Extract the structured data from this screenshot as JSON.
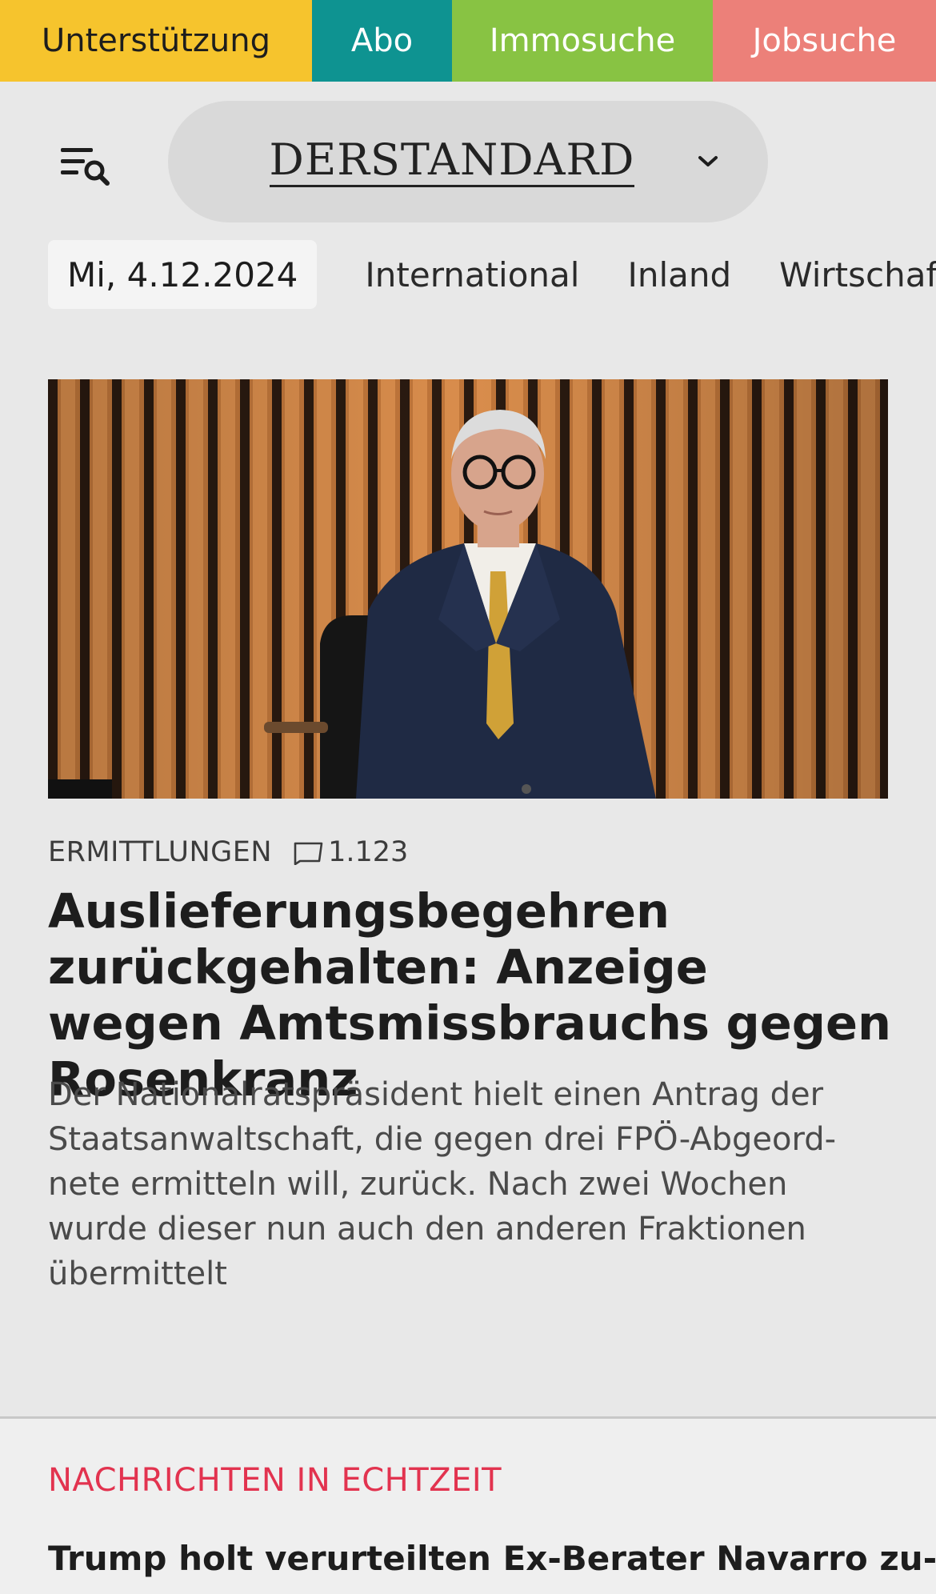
{
  "service_bar": [
    {
      "label": "Unterstützung",
      "color": "#f6c42d"
    },
    {
      "label": "Abo",
      "color": "#0e9391"
    },
    {
      "label": "Immosuche",
      "color": "#88c343"
    },
    {
      "label": "Jobsuche",
      "color": "#ec8079"
    }
  ],
  "header": {
    "menu_icon": "menu-search-icon",
    "logo_text": "DERSTANDARD",
    "dropdown_icon": "chevron-down-icon"
  },
  "nav": {
    "date": "Mi, 4.12.2024",
    "items": [
      "International",
      "Inland",
      "Wirtschaft"
    ]
  },
  "lead": {
    "kicker": "ERMITTLUNGEN",
    "comment_icon": "comment-icon",
    "comment_count": "1.123",
    "headline": "Auslieferungsbegehren zurückge­halten: Anzeige wegen Amtsmiss­brauchs gegen Rosenkranz",
    "teaser": "Der Nationalratspräsident hielt einen Antrag der Staatsanwaltschaft, die gegen drei FPÖ-Abgeord­nete ermitteln will, zurück. Nach zwei Wochen wurde dieser nun auch den anderen Fraktionen übermittelt"
  },
  "live": {
    "title": "NACHRICHTEN IN ECHTZEIT",
    "headline": "Trump holt verurteilten Ex-Berater Navarro zu-"
  },
  "colors": {
    "background": "#e8e8e8",
    "live_accent": "#e2334f"
  }
}
